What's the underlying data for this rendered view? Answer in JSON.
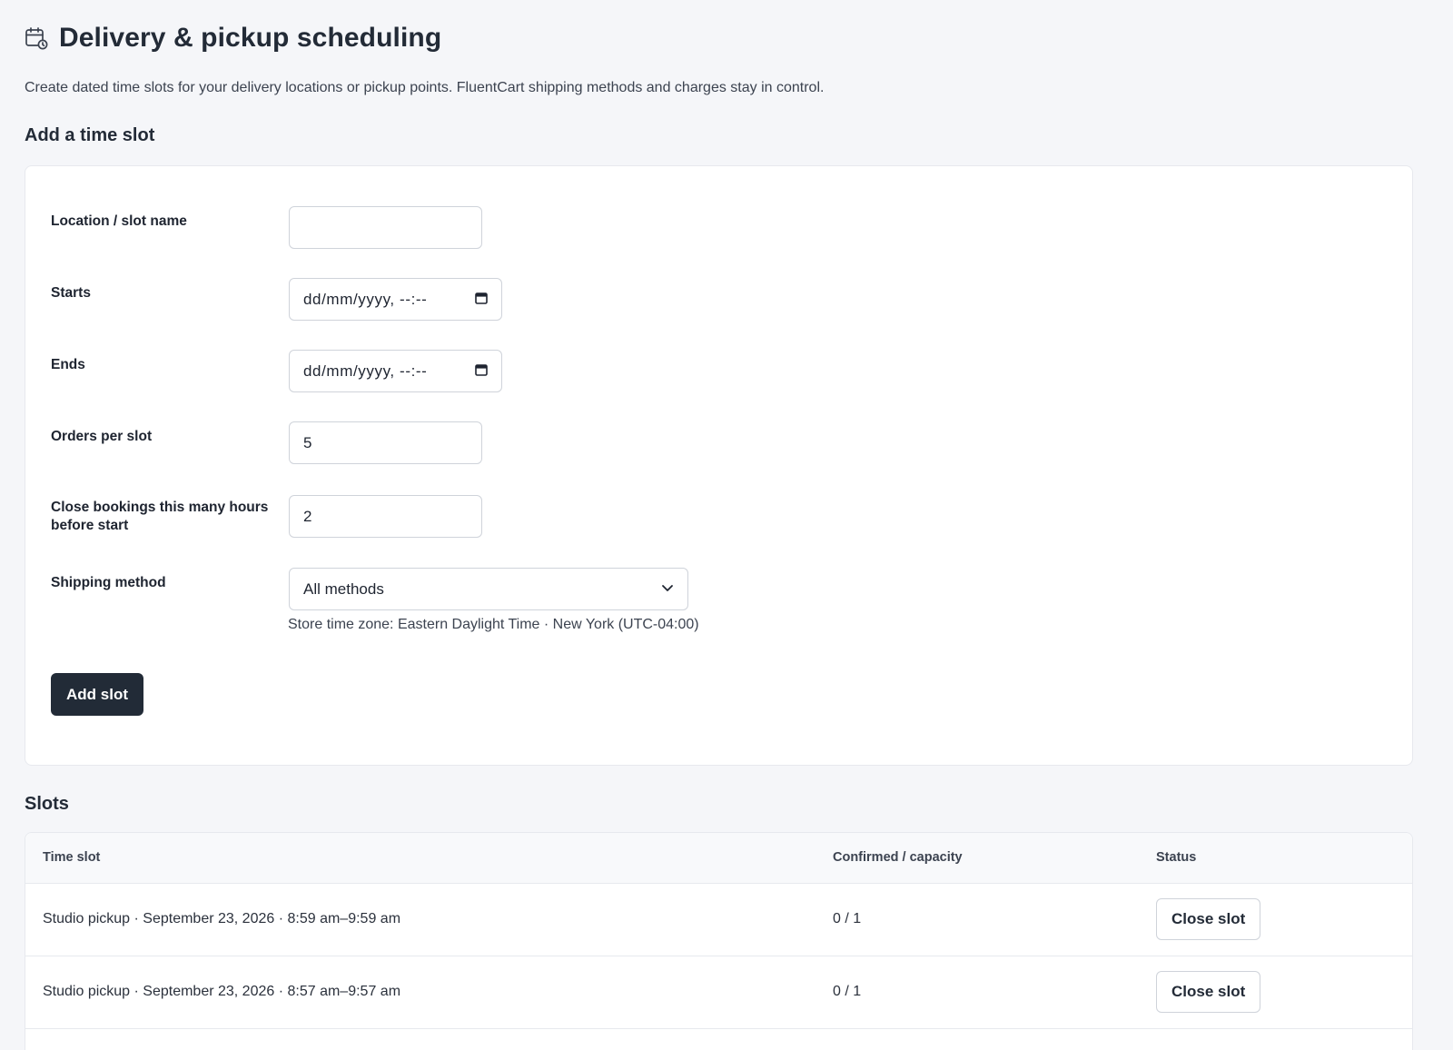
{
  "header": {
    "title": "Delivery & pickup scheduling",
    "icon": "calendar-clock-icon",
    "subtitle": "Create dated time slots for your delivery locations or pickup points. FluentCart shipping methods and charges stay in control."
  },
  "add_section": {
    "heading": "Add a time slot",
    "fields": {
      "name_label": "Location / slot name",
      "name_value": "",
      "starts_label": "Starts",
      "starts_placeholder": "dd/mm/yyyy, --:--",
      "ends_label": "Ends",
      "ends_placeholder": "dd/mm/yyyy, --:--",
      "orders_label": "Orders per slot",
      "orders_value": "5",
      "close_label": "Close bookings this many hours before start",
      "close_value": "2",
      "shipping_label": "Shipping method",
      "shipping_selected": "All methods"
    },
    "timezone_note": "Store time zone: Eastern Daylight Time · New York (UTC-04:00)",
    "add_button": "Add slot"
  },
  "slots_section": {
    "heading": "Slots",
    "columns": [
      "Time slot",
      "Confirmed / capacity",
      "Status"
    ],
    "rows": [
      {
        "time_slot": "Studio pickup · September 23, 2026 · 8:59 am–9:59 am",
        "capacity": "0 / 1",
        "action": "Close slot"
      },
      {
        "time_slot": "Studio pickup · September 23, 2026 · 8:57 am–9:57 am",
        "capacity": "0 / 1",
        "action": "Close slot"
      }
    ]
  },
  "colors": {
    "background": "#f5f6f9",
    "primary_button": "#222b37",
    "border": "#cfd3da"
  }
}
